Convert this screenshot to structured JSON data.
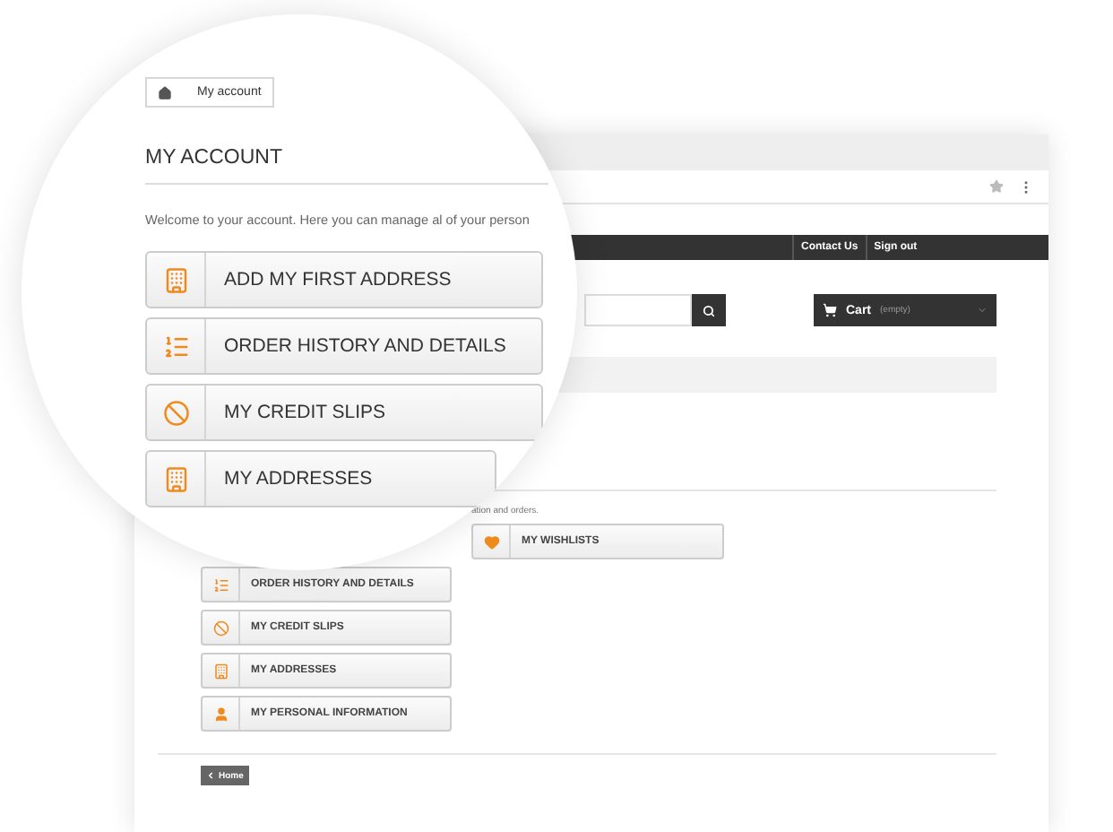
{
  "browser": {
    "nav_links": [
      "Contact Us",
      "Sign out"
    ],
    "cart": {
      "label": "Cart",
      "status": "(empty)"
    },
    "intro_fragment": "ation and orders.",
    "account_links": [
      {
        "label": "ORDER HISTORY AND DETAILS",
        "kind": "list"
      },
      {
        "label": "MY CREDIT SLIPS",
        "kind": "ban"
      },
      {
        "label": "MY ADDRESSES",
        "kind": "address"
      },
      {
        "label": "MY PERSONAL INFORMATION",
        "kind": "person"
      }
    ],
    "wishlist": {
      "label": "MY WISHLISTS",
      "kind": "heart"
    },
    "home_button": "Home"
  },
  "magnifier": {
    "breadcrumb": "My account",
    "title": "MY ACCOUNT",
    "welcome": "Welcome to your account. Here you can manage al of your person",
    "links": [
      {
        "label": "ADD MY FIRST ADDRESS",
        "kind": "address"
      },
      {
        "label": "ORDER HISTORY AND DETAILS",
        "kind": "list"
      },
      {
        "label": "MY CREDIT SLIPS",
        "kind": "ban"
      },
      {
        "label": "MY ADDRESSES",
        "kind": "address"
      }
    ]
  }
}
